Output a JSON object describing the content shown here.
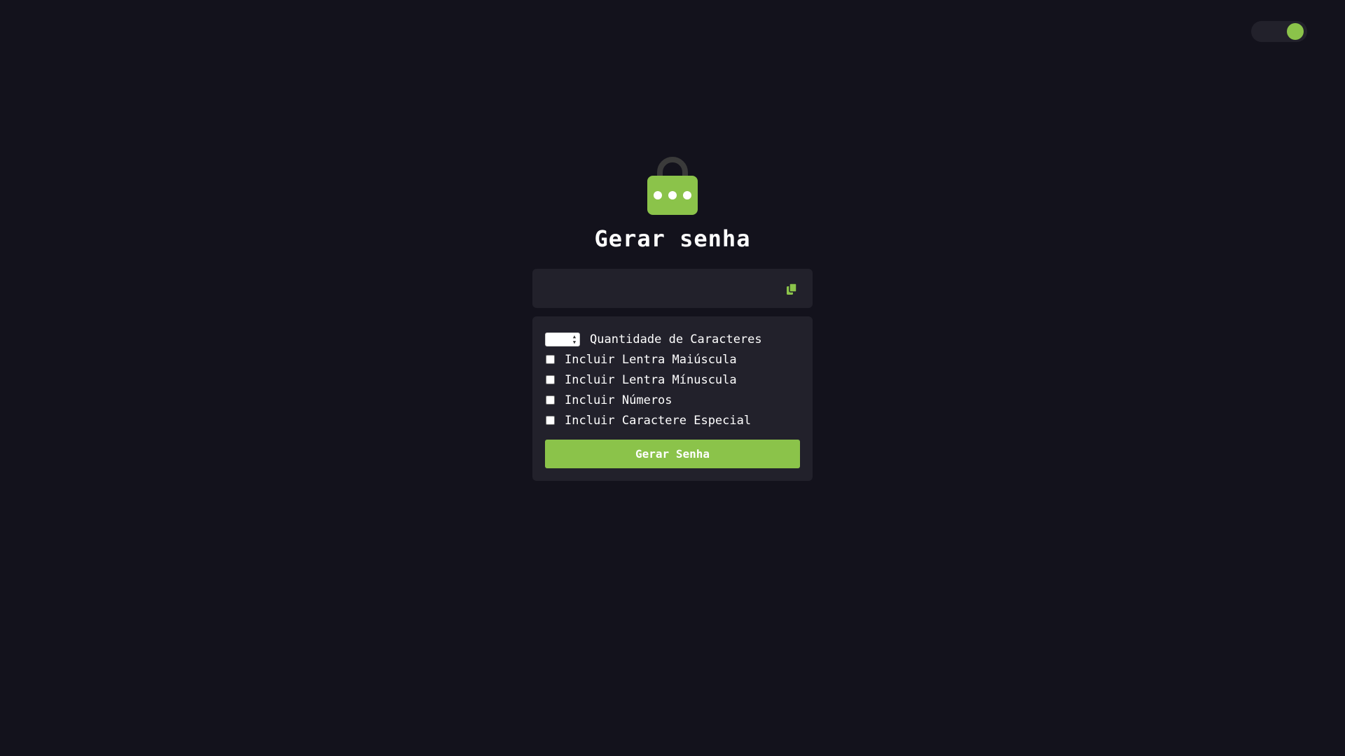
{
  "theme_toggle": {
    "state": "on",
    "color": "#8bc34a"
  },
  "header": {
    "icon": "lock-icon",
    "title": "Gerar senha"
  },
  "output": {
    "value": "",
    "copy_icon": "copy-icon"
  },
  "options": {
    "quantity_label": "Quantidade de Caracteres",
    "quantity_value": "",
    "uppercase_label": "Incluir Lentra Maiúscula",
    "lowercase_label": "Incluir Lentra Mínuscula",
    "numbers_label": "Incluir Números",
    "special_label": "Incluir Caractere Especial",
    "uppercase_checked": false,
    "lowercase_checked": false,
    "numbers_checked": false,
    "special_checked": false
  },
  "generate_button": {
    "label": "Gerar Senha"
  },
  "colors": {
    "background": "#13121c",
    "panel": "#22212b",
    "accent": "#8bc34a",
    "lock_shackle": "#3a3a3a"
  }
}
